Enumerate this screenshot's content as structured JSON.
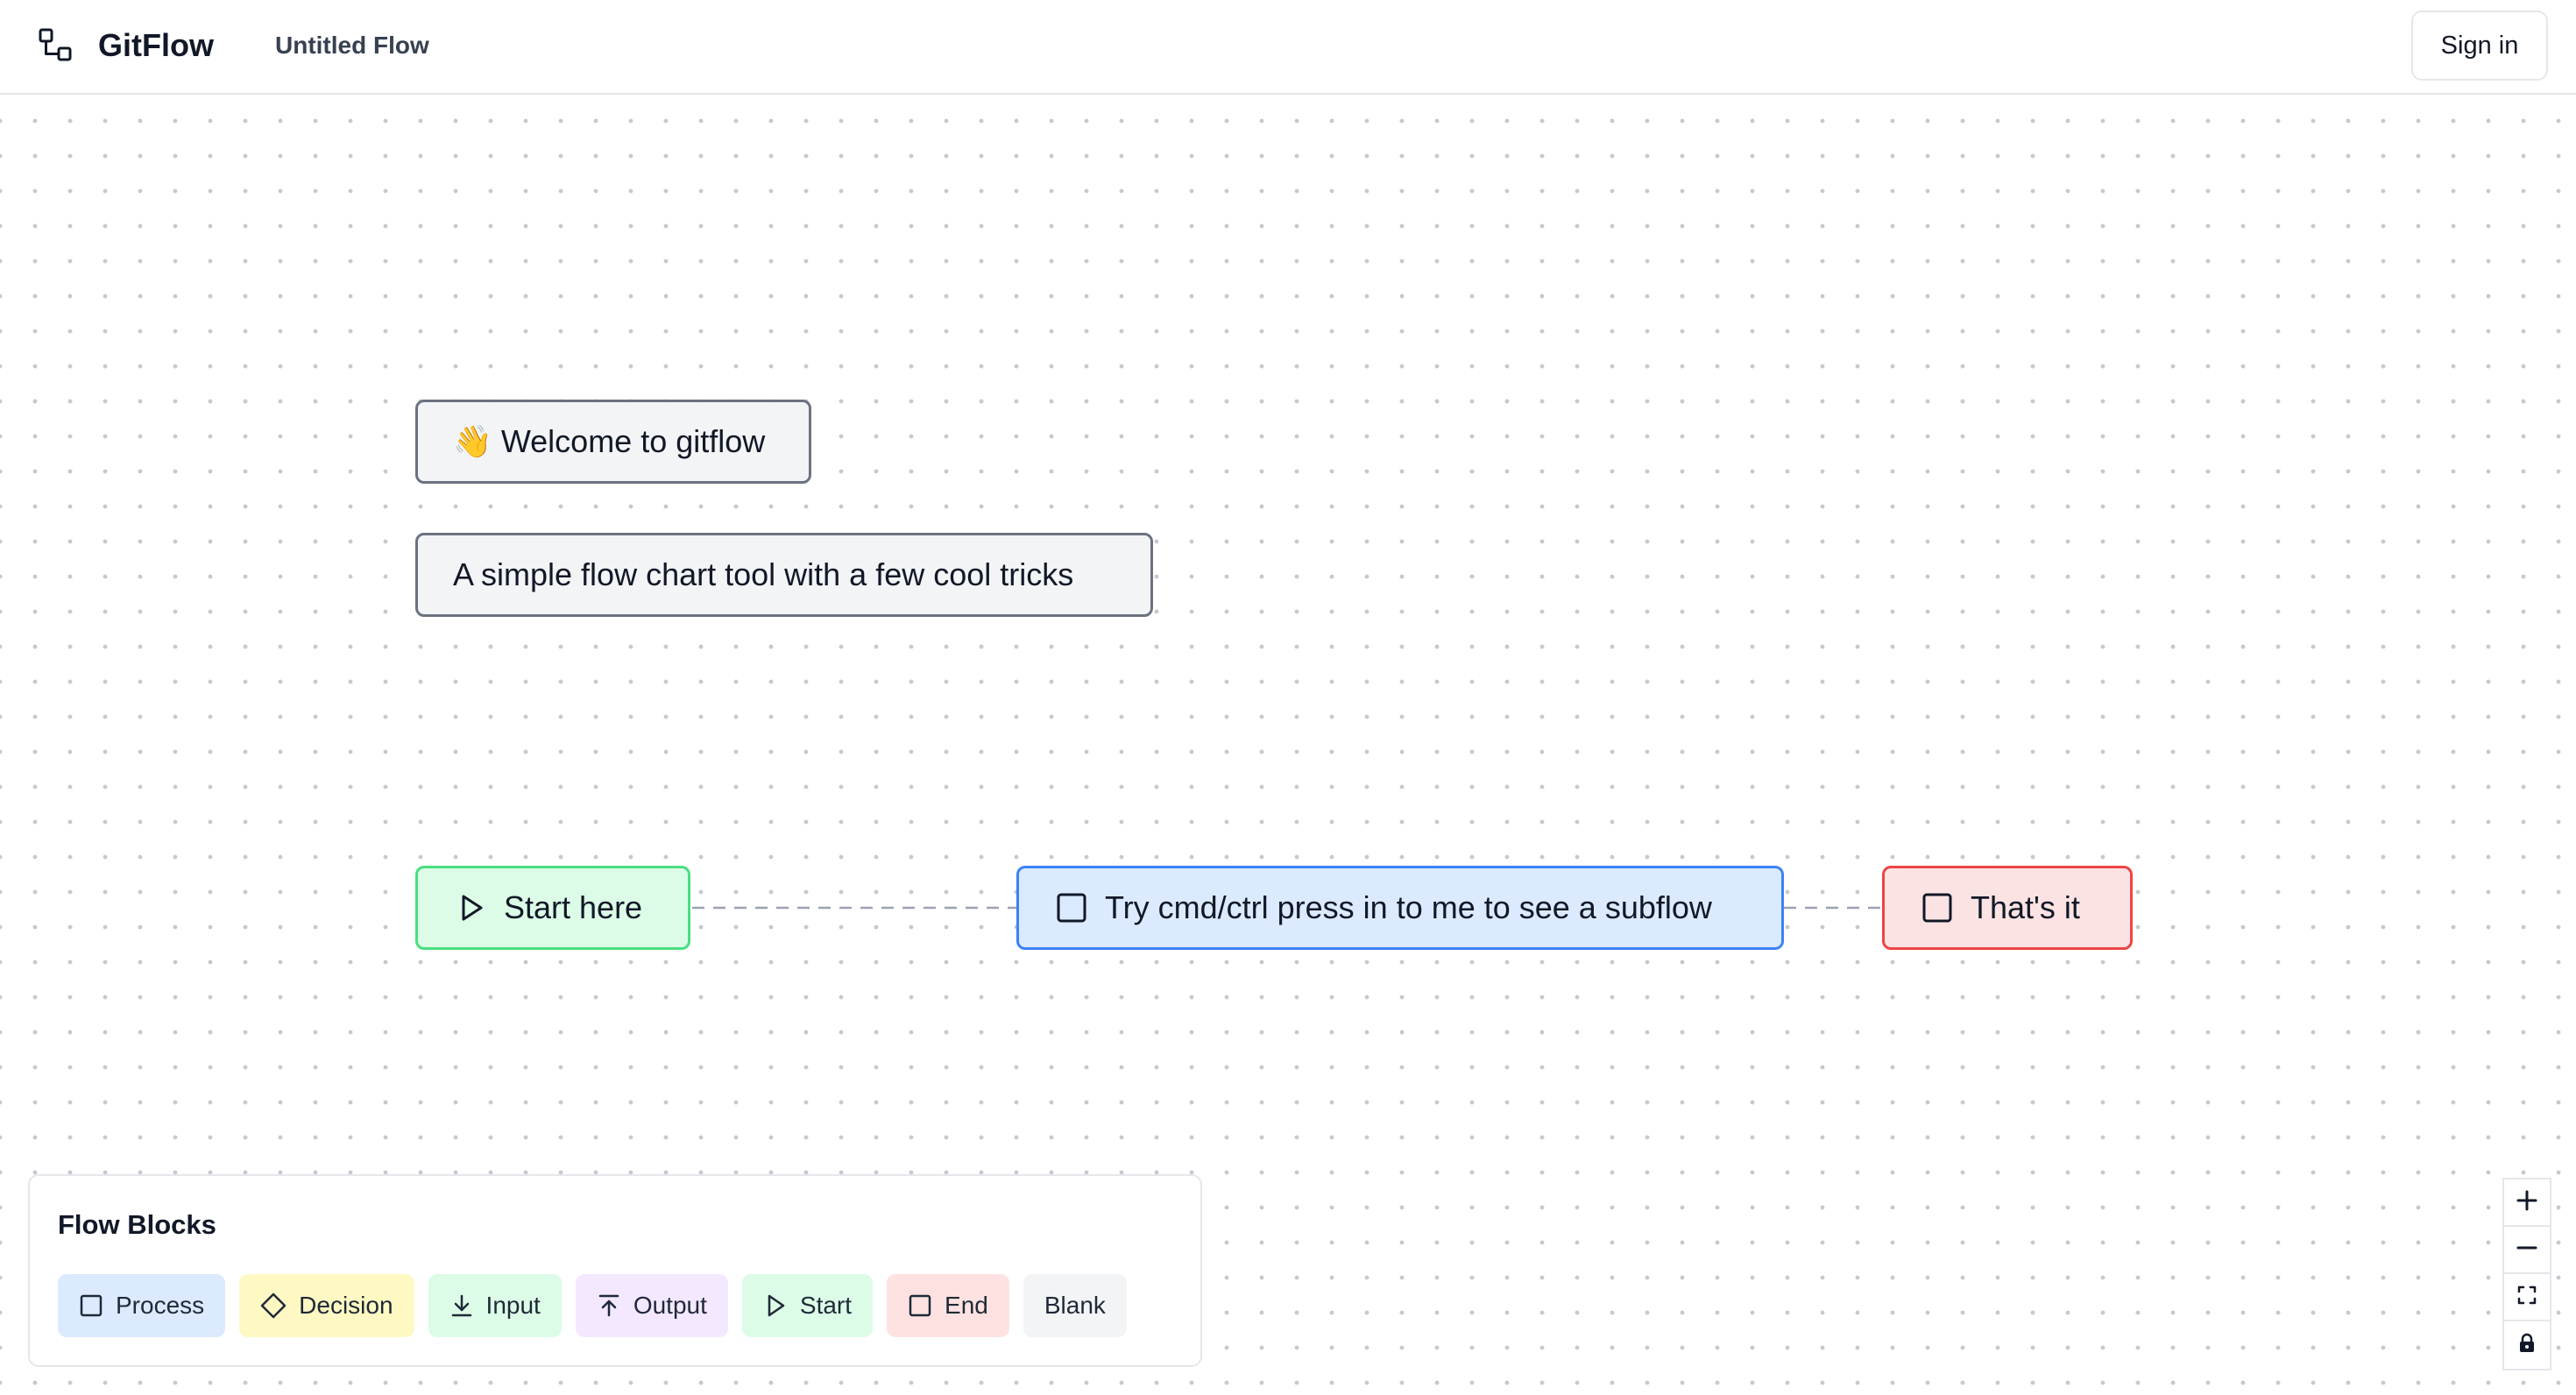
{
  "header": {
    "app_name": "GitFlow",
    "flow_title": "Untitled Flow",
    "sign_in_label": "Sign in"
  },
  "canvas": {
    "nodes": {
      "welcome": "👋 Welcome to gitflow",
      "subtitle": "A simple flow chart tool with a few cool tricks",
      "start": "Start here",
      "process": "Try cmd/ctrl press in to me to see a subflow",
      "end": "That's it"
    }
  },
  "flow_blocks": {
    "title": "Flow Blocks",
    "items": [
      {
        "label": "Process",
        "icon": "square-icon",
        "color": "#dbeafe"
      },
      {
        "label": "Decision",
        "icon": "diamond-icon",
        "color": "#fef9c3"
      },
      {
        "label": "Input",
        "icon": "download-icon",
        "color": "#dcfce7"
      },
      {
        "label": "Output",
        "icon": "upload-icon",
        "color": "#f3e8ff"
      },
      {
        "label": "Start",
        "icon": "play-icon",
        "color": "#dcfce7"
      },
      {
        "label": "End",
        "icon": "square-icon",
        "color": "#fee2e2"
      },
      {
        "label": "Blank",
        "icon": "",
        "color": "#f3f4f6"
      }
    ]
  },
  "zoom_controls": [
    "zoom-in-icon",
    "zoom-out-icon",
    "fit-view-icon",
    "lock-icon"
  ]
}
